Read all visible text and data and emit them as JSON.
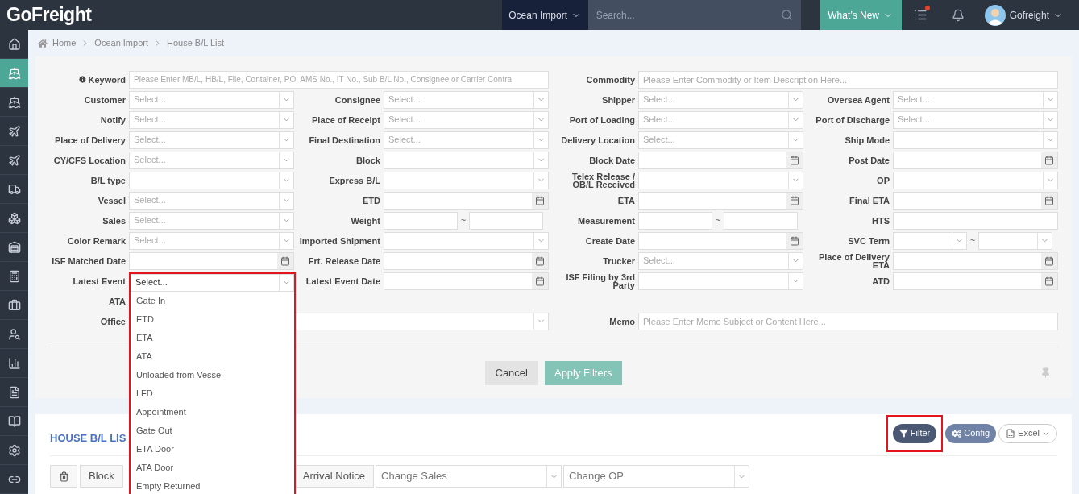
{
  "topbar": {
    "logo": "GoFreight",
    "module": "Ocean Import",
    "search_placeholder": "Search...",
    "whats_new": "What’s New",
    "tasks_unread": true,
    "user": "Gofreight"
  },
  "sidebar": [
    {
      "selected": false
    },
    {
      "selected": true
    },
    {
      "selected": false
    },
    {
      "selected": false
    },
    {
      "selected": false
    },
    {
      "selected": false
    },
    {
      "selected": false
    },
    {
      "selected": false
    },
    {
      "selected": false
    },
    {
      "selected": false
    },
    {
      "selected": false
    },
    {
      "selected": false
    },
    {
      "selected": false
    },
    {
      "selected": false
    },
    {
      "selected": false
    },
    {
      "selected": false
    }
  ],
  "breadcrumb": [
    "Home",
    "Ocean Import",
    "House B/L List"
  ],
  "filters": {
    "rows": [
      [
        {
          "label": "Keyword",
          "kind": "text",
          "wide": true,
          "info": true,
          "placeholder": "Please Enter MB/L, HB/L, File, Container, PO, AMS No., IT No., Sub B/L No., Consignee or Carrier Contra"
        },
        {
          "label": "Commodity",
          "kind": "text",
          "wide": true,
          "placeholder": "Please Enter Commodity or Item Description Here..."
        }
      ],
      [
        {
          "label": "Customer",
          "kind": "select",
          "placeholder": "Select..."
        },
        {
          "label": "Consignee",
          "kind": "select",
          "placeholder": "Select..."
        },
        {
          "label": "Shipper",
          "kind": "select",
          "placeholder": "Select..."
        },
        {
          "label": "Oversea Agent",
          "kind": "select",
          "placeholder": "Select..."
        }
      ],
      [
        {
          "label": "Notify",
          "kind": "select",
          "placeholder": "Select..."
        },
        {
          "label": "Place of Receipt",
          "kind": "select",
          "placeholder": "Select..."
        },
        {
          "label": "Port of Loading",
          "kind": "select",
          "placeholder": "Select..."
        },
        {
          "label": "Port of Discharge",
          "kind": "select",
          "placeholder": "Select..."
        }
      ],
      [
        {
          "label": "Place of Delivery",
          "kind": "select",
          "placeholder": "Select..."
        },
        {
          "label": "Final Destination",
          "kind": "select",
          "placeholder": "Select..."
        },
        {
          "label": "Delivery Location",
          "kind": "select",
          "placeholder": "Select..."
        },
        {
          "label": "Ship Mode",
          "kind": "select"
        }
      ],
      [
        {
          "label": "CY/CFS Location",
          "kind": "select",
          "placeholder": "Select..."
        },
        {
          "label": "Block",
          "kind": "select"
        },
        {
          "label": "Block Date",
          "kind": "date"
        },
        {
          "label": "Post Date",
          "kind": "date"
        }
      ],
      [
        {
          "label": "B/L type",
          "kind": "select"
        },
        {
          "label": "Express B/L",
          "kind": "select"
        },
        {
          "label": "Telex Release / OB/L Received",
          "kind": "select"
        },
        {
          "label": "OP",
          "kind": "select"
        }
      ],
      [
        {
          "label": "Vessel",
          "kind": "select",
          "placeholder": "Select..."
        },
        {
          "label": "ETD",
          "kind": "date"
        },
        {
          "label": "ETA",
          "kind": "date"
        },
        {
          "label": "Final ETA",
          "kind": "date"
        }
      ],
      [
        {
          "label": "Sales",
          "kind": "select",
          "placeholder": "Select..."
        },
        {
          "label": "Weight",
          "kind": "range",
          "separator": "~"
        },
        {
          "label": "Measurement",
          "kind": "range",
          "separator": "~"
        },
        {
          "label": "HTS",
          "kind": "text"
        }
      ],
      [
        {
          "label": "Color Remark",
          "kind": "select",
          "placeholder": "Select..."
        },
        {
          "label": "Imported Shipment",
          "kind": "select"
        },
        {
          "label": "Create Date",
          "kind": "date"
        },
        {
          "label": "SVC Term",
          "kind": "select-range",
          "separator": "~"
        }
      ],
      [
        {
          "label": "ISF Matched Date",
          "kind": "date"
        },
        {
          "label": "Frt. Release Date",
          "kind": "date"
        },
        {
          "label": "Trucker",
          "kind": "select",
          "placeholder": "Select..."
        },
        {
          "label": "Place of Delivery ETA",
          "kind": "date"
        }
      ],
      [
        {
          "label": "Latest Event",
          "kind": "select",
          "placeholder": "Select...",
          "open": true,
          "highlighted": true,
          "options": [
            "Gate In",
            "ETD",
            "ETA",
            "ATA",
            "Unloaded from Vessel",
            "LFD",
            "Appointment",
            "Gate Out",
            "ETA Door",
            "ATA Door",
            "Empty Returned"
          ]
        },
        {
          "label": "Latest Event Date",
          "kind": "date"
        },
        {
          "label": "ISF Filing by 3rd Party",
          "kind": "select"
        },
        {
          "label": "ATD",
          "kind": "date"
        }
      ],
      [
        {
          "label": "ATA",
          "kind": "covered"
        }
      ],
      [
        {
          "label": "Office",
          "kind": "select",
          "wide": true
        },
        {
          "label": "Memo",
          "kind": "text",
          "wide": true,
          "placeholder": "Please Enter Memo Subject or Content Here..."
        }
      ]
    ],
    "cancel": "Cancel",
    "apply": "Apply Filters"
  },
  "list": {
    "title": "HOUSE B/L LIS",
    "actions": [
      {
        "kind": "filter",
        "label": "Filter",
        "highlighted": true
      },
      {
        "kind": "config",
        "label": "Config",
        "highlighted": false
      },
      {
        "kind": "excel",
        "label": "Excel",
        "highlighted": false
      }
    ],
    "toolbar_left": [
      {
        "kind": "delete"
      },
      {
        "kind": "button",
        "label": "Block"
      }
    ],
    "toolbar_right": [
      {
        "kind": "button",
        "label": "Arrival Notice"
      },
      {
        "kind": "select",
        "placeholder": "Change Sales"
      },
      {
        "kind": "select",
        "placeholder": "Change OP"
      }
    ]
  }
}
